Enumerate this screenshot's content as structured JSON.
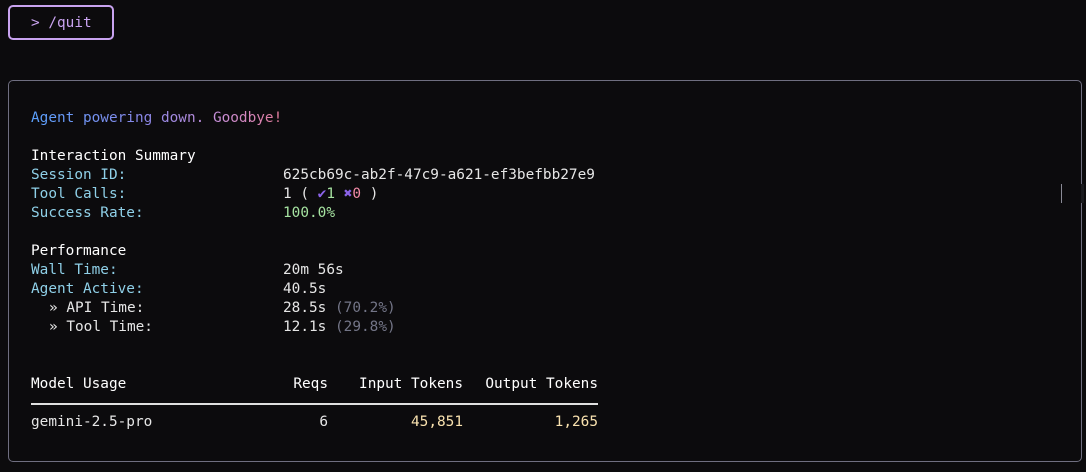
{
  "command": {
    "prompt": ">",
    "text": "/quit"
  },
  "goodbye": "Agent powering down. Goodbye!",
  "summary": {
    "heading": "Interaction Summary",
    "session_label": "Session ID:",
    "session_value": "625cb69c-ab2f-47c9-a621-ef3befbb27e9",
    "tool_calls_label": "Tool Calls:",
    "tool_calls_total": "1",
    "tool_calls_success": "1",
    "tool_calls_fail": "0",
    "success_rate_label": "Success Rate:",
    "success_rate_value": "100.0%"
  },
  "performance": {
    "heading": "Performance",
    "wall_time_label": "Wall Time:",
    "wall_time_value": "20m 56s",
    "agent_active_label": "Agent Active:",
    "agent_active_value": "40.5s",
    "api_time_label": "» API Time:",
    "api_time_value": "28.5s",
    "api_time_pct": "(70.2%)",
    "tool_time_label": "» Tool Time:",
    "tool_time_value": "12.1s",
    "tool_time_pct": "(29.8%)"
  },
  "model_usage": {
    "headers": {
      "model": "Model Usage",
      "reqs": "Reqs",
      "input": "Input Tokens",
      "output": "Output Tokens"
    },
    "rows": [
      {
        "model": "gemini-2.5-pro",
        "reqs": "6",
        "input": "45,851",
        "output": "1,265"
      }
    ]
  },
  "icons": {
    "success": "check-icon",
    "fail": "cross-icon"
  },
  "colors": {
    "accent_purple": "#c9a3f0",
    "label_blue": "#8fd0e8",
    "success_green": "#a6e3a1",
    "token_yellow": "#f9e2af",
    "error_pink": "#f38ba8",
    "muted": "#737587"
  }
}
